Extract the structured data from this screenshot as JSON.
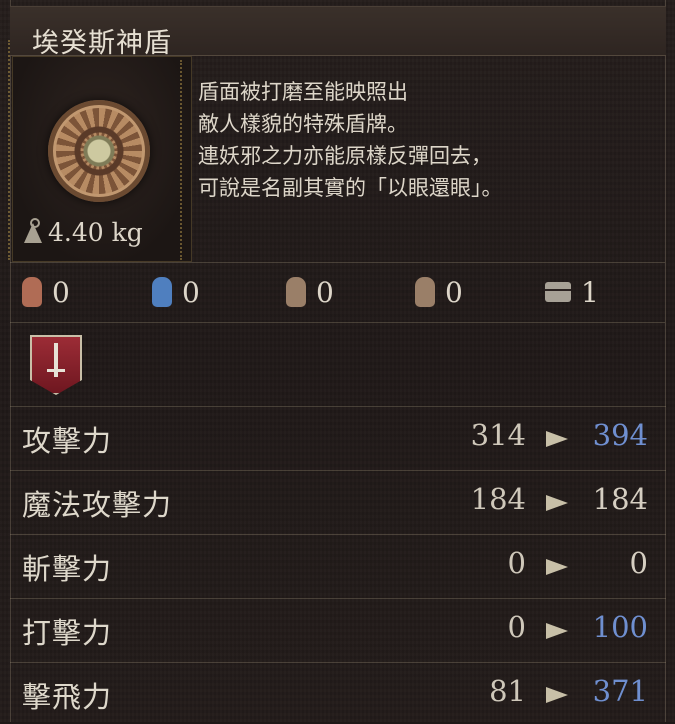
{
  "item": {
    "title": "埃癸斯神盾",
    "icon": "shield-with-eye-emblem",
    "weight": "4.40 kg",
    "description": "盾面被打磨至能映照出\n敵人樣貌的特殊盾牌。\n連妖邪之力亦能原樣反彈回去，\n可說是名副其實的「以眼還眼」。"
  },
  "requirements": [
    {
      "icon": "strength-hand-icon",
      "value": "0",
      "color": "#b06c55"
    },
    {
      "icon": "intelligence-hand-icon",
      "value": "0",
      "color": "#4f7fbf"
    },
    {
      "icon": "dexterity-hand-icon",
      "value": "0",
      "color": "#9a7f68"
    },
    {
      "icon": "faith-hand-icon",
      "value": "0",
      "color": "#9a7f68"
    },
    {
      "icon": "slot-chest-icon",
      "value": "1",
      "color": "#a7a196"
    }
  ],
  "stats": [
    {
      "label": "攻擊力",
      "old": "314",
      "new": "394",
      "new_color": "#6f8fd0"
    },
    {
      "label": "魔法攻擊力",
      "old": "184",
      "new": "184",
      "new_color": "#d6cfc2"
    },
    {
      "label": "斬擊力",
      "old": "0",
      "new": "0",
      "new_color": "#d6cfc2"
    },
    {
      "label": "打擊力",
      "old": "0",
      "new": "100",
      "new_color": "#6f8fd0"
    },
    {
      "label": "擊飛力",
      "old": "81",
      "new": "371",
      "new_color": "#6f8fd0"
    }
  ]
}
